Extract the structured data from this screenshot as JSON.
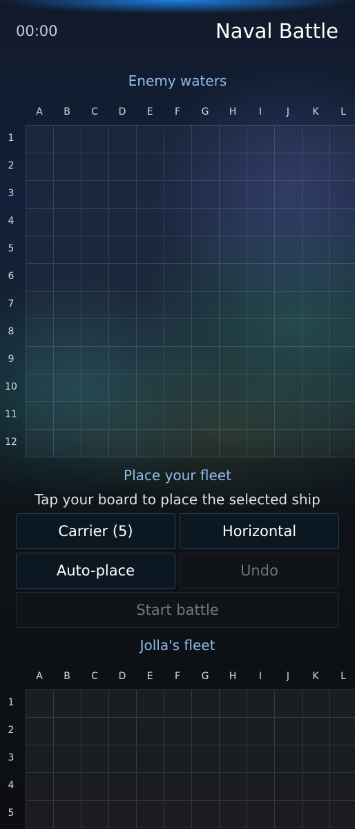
{
  "header": {
    "timer": "00:00",
    "title": "Naval Battle"
  },
  "enemy_board": {
    "title": "Enemy waters",
    "columns": [
      "A",
      "B",
      "C",
      "D",
      "E",
      "F",
      "G",
      "H",
      "I",
      "J",
      "K",
      "L"
    ],
    "rows": [
      "1",
      "2",
      "3",
      "4",
      "5",
      "6",
      "7",
      "8",
      "9",
      "10",
      "11",
      "12"
    ]
  },
  "placement": {
    "title": "Place your fleet",
    "hint": "Tap your board to place the selected ship",
    "ship_button": "Carrier (5)",
    "orientation_button": "Horizontal",
    "auto_place_button": "Auto-place",
    "undo_button": "Undo",
    "start_button": "Start battle"
  },
  "own_board": {
    "title": "Jolla's fleet",
    "columns": [
      "A",
      "B",
      "C",
      "D",
      "E",
      "F",
      "G",
      "H",
      "I",
      "J",
      "K",
      "L"
    ],
    "rows": [
      "1",
      "2",
      "3",
      "4",
      "5"
    ]
  },
  "colors": {
    "accent": "#8fbbe8",
    "top_glow": "#1e8cff",
    "disabled_text": "#6f767d"
  }
}
